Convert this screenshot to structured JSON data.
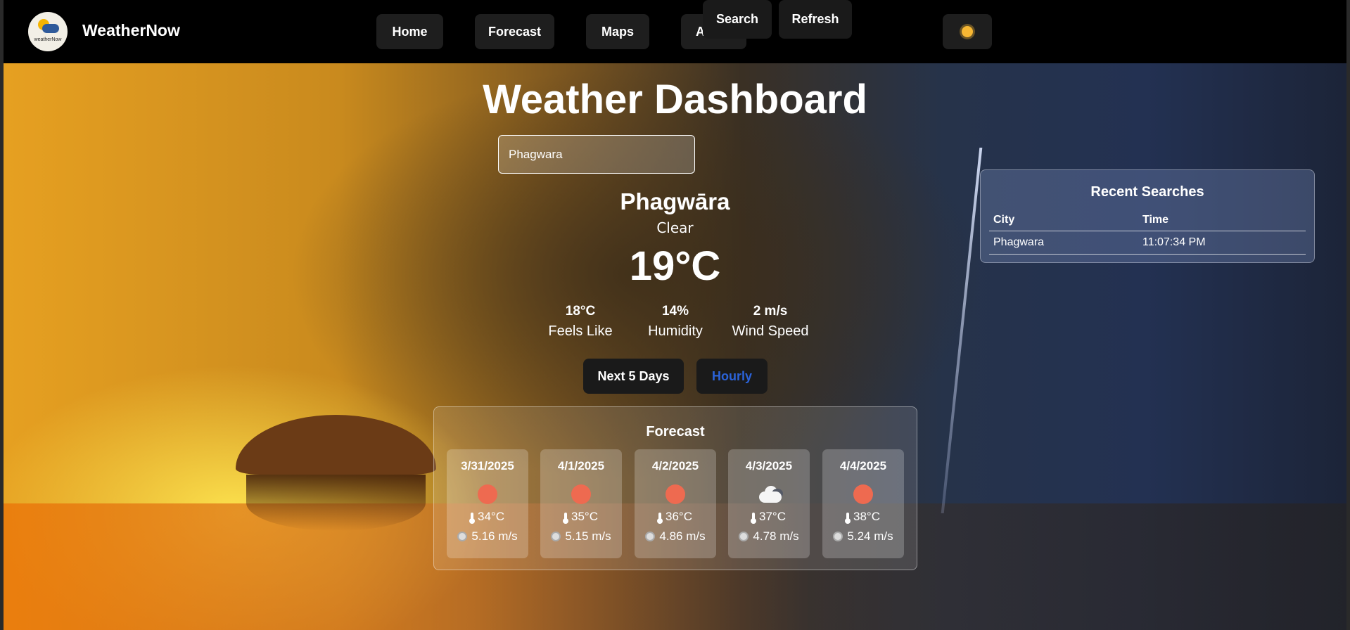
{
  "navbar": {
    "logo_text": "weatherNow",
    "brand": "WeatherNow",
    "links": [
      "Home",
      "Forecast",
      "Maps",
      "Alerts"
    ],
    "theme_icon": "sun-icon"
  },
  "main": {
    "title": "Weather Dashboard",
    "search": {
      "value": "Phagwara",
      "placeholder": ""
    },
    "search_label": "Search",
    "refresh_label": "Refresh",
    "city": "Phagwāra",
    "condition": "Clear",
    "temperature": "19°C",
    "stats": [
      {
        "value": "18°C",
        "label": "Feels Like"
      },
      {
        "value": "14%",
        "label": "Humidity"
      },
      {
        "value": "2 m/s",
        "label": "Wind Speed"
      }
    ],
    "tabs": [
      {
        "label": "Next 5 Days",
        "active": true
      },
      {
        "label": "Hourly",
        "active": false
      }
    ],
    "accent_color": "#2b63d9"
  },
  "forecast": {
    "title": "Forecast",
    "days": [
      {
        "date": "3/31/2025",
        "icon": "sun-icon",
        "temp": "34°C",
        "wind": "5.16 m/s"
      },
      {
        "date": "4/1/2025",
        "icon": "sun-icon",
        "temp": "35°C",
        "wind": "5.15 m/s"
      },
      {
        "date": "4/2/2025",
        "icon": "sun-icon",
        "temp": "36°C",
        "wind": "4.86 m/s"
      },
      {
        "date": "4/3/2025",
        "icon": "cloud-icon",
        "temp": "37°C",
        "wind": "4.78 m/s"
      },
      {
        "date": "4/4/2025",
        "icon": "sun-icon",
        "temp": "38°C",
        "wind": "5.24 m/s"
      }
    ]
  },
  "recent": {
    "title": "Recent Searches",
    "columns": [
      "City",
      "Time"
    ],
    "rows": [
      {
        "city": "Phagwara",
        "time": "11:07:34 PM"
      }
    ]
  }
}
